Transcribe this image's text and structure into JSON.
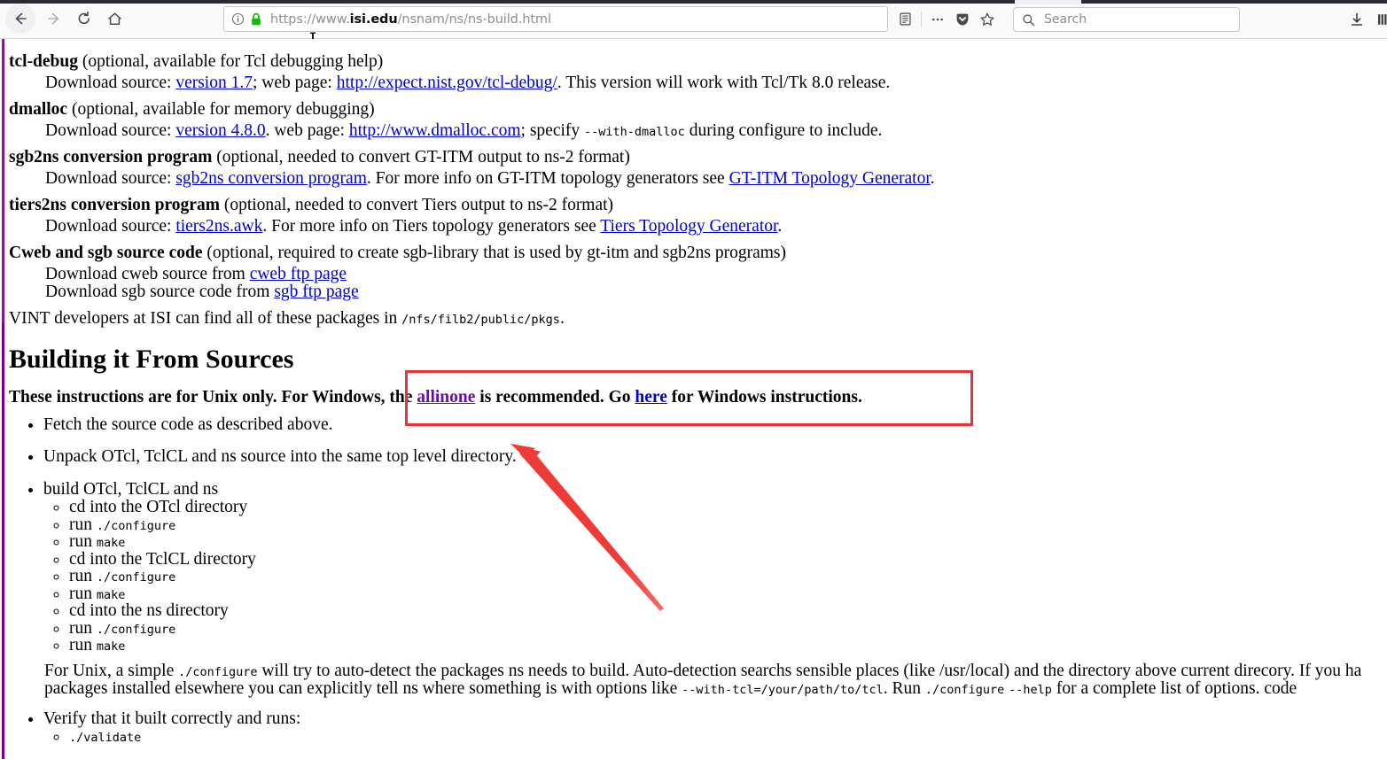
{
  "browser": {
    "back_label": "Back",
    "forward_label": "Forward",
    "reload_label": "Reload",
    "home_label": "Home",
    "url": {
      "scheme": "https://www.",
      "host": "isi.edu",
      "path": "/nsnam/ns/ns-build.html",
      "full": "https://www.isi.edu/nsnam/ns/ns-build.html"
    },
    "search": {
      "placeholder": "Search",
      "value": ""
    },
    "icons": {
      "identity": "info-circle-icon",
      "lock": "padlock-icon",
      "reader": "reader-view-icon",
      "page_actions": "ellipsis-icon",
      "pocket": "pocket-shield-icon",
      "bookmark": "star-icon",
      "search": "search-icon",
      "downloads": "download-arrow-icon",
      "library": "library-icon"
    }
  },
  "page": {
    "packages": [
      {
        "name": "tcl-debug",
        "desc": " (optional, available for Tcl debugging help)",
        "sub_prefix": "Download source: ",
        "link1": "version 1.7",
        "mid": "; web page: ",
        "link2": "http://expect.nist.gov/tcl-debug/",
        "sub_suffix": ". This version will work with Tcl/Tk 8.0 release."
      },
      {
        "name": "dmalloc",
        "desc": " (optional, available for memory debugging)",
        "sub_prefix": "Download source: ",
        "link1": "version 4.8.0",
        "mid": ". web page: ",
        "link2": "http://www.dmalloc.com",
        "sub_suffix": "; specify ",
        "code": "--with-dmalloc",
        "sub_tail": " during configure to include."
      },
      {
        "name": "sgb2ns conversion program",
        "desc": " (optional, needed to convert GT-ITM output to ns-2 format)",
        "sub_prefix": "Download source: ",
        "link1": "sgb2ns conversion program",
        "mid": ". For more info on GT-ITM topology generators see ",
        "link2": "GT-ITM Topology Generator",
        "sub_suffix": "."
      },
      {
        "name": "tiers2ns conversion program",
        "desc": " (optional, needed to convert Tiers output to ns-2 format)",
        "sub_prefix": "Download source: ",
        "link1": "tiers2ns.awk",
        "mid": ". For more info on Tiers topology generators see ",
        "link2": "Tiers Topology Generator",
        "sub_suffix": "."
      }
    ],
    "cweb": {
      "name": "Cweb and sgb source code",
      "desc": " (optional, required to create sgb-library that is used by gt-itm and sgb2ns programs)",
      "line1_prefix": "Download cweb source from ",
      "line1_link": "cweb ftp page",
      "line2_prefix": "Download sgb source code from ",
      "line2_link": "sgb ftp page"
    },
    "vint_note_prefix": "VINT developers at ISI can find all of these packages in ",
    "vint_note_code": "/nfs/filb2/public/pkgs",
    "vint_note_suffix": ".",
    "section_heading": "Building it From Sources",
    "instructions_note": {
      "part1": "These instructions are for Unix only. For Windows, the ",
      "link_allinone": "allinone",
      "part2": " is recommended. Go ",
      "link_here": "here",
      "part3": " for Windows instructions."
    },
    "steps": [
      {
        "text": "Fetch the source code as described above."
      },
      {
        "text": "Unpack OTcl, TclCL and ns source into the same top level directory."
      }
    ],
    "build_step": {
      "text": "build OTcl, TclCL and ns",
      "substeps": [
        {
          "text": "cd into the OTcl directory",
          "code": ""
        },
        {
          "text": "run ",
          "code": "./configure"
        },
        {
          "text": "run ",
          "code": "make"
        },
        {
          "text": "cd into the TclCL directory",
          "code": ""
        },
        {
          "text": "run ",
          "code": "./configure"
        },
        {
          "text": "run ",
          "code": "make"
        },
        {
          "text": "cd into the ns directory",
          "code": ""
        },
        {
          "text": "run ",
          "code": "./configure"
        },
        {
          "text": "run ",
          "code": "make"
        }
      ]
    },
    "unix_para": {
      "l1_a": "For Unix, a simple ",
      "l1_code": "./configure",
      "l1_b": " will try to auto-detect the packages ns needs to build. Auto-detection searchs sensible places (like /usr/local) and the directory above current direcory. If you ha",
      "l2_a": "packages installed elsewhere you can explicitly tell ns where something is with options like ",
      "l2_code1": "--with-tcl=/your/path/to/tcl",
      "l2_b": ". Run ",
      "l2_code2": "./configure",
      "l2_c": " ",
      "l2_code3": "--help",
      "l2_d": " for a complete list of options. code"
    },
    "verify_step": {
      "text": "Verify that it built correctly and runs:",
      "sub_code": "./validate"
    }
  },
  "annotations": {
    "highlight_box": "red-rectangle-highlight",
    "arrow": "red-arrow-pointing-to-allinone",
    "box_color": "#e8333a",
    "arrow_color": "#ef3b38"
  }
}
